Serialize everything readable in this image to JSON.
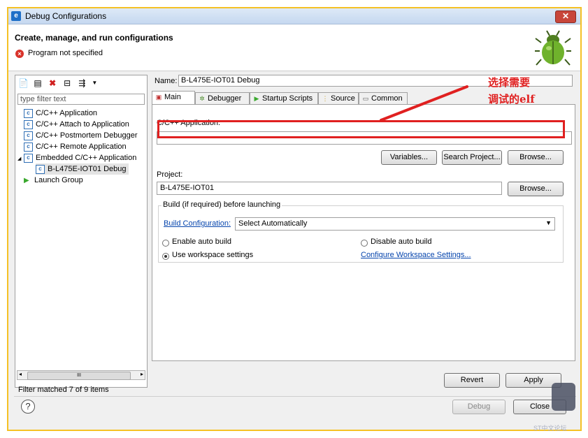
{
  "window": {
    "title": "Debug Configurations",
    "close_glyph": "✕"
  },
  "header": {
    "title": "Create, manage, and run configurations",
    "message": "Program not specified"
  },
  "left": {
    "filter_placeholder": "type filter text",
    "tree": [
      {
        "label": "C/C++ Application",
        "icon": "c-config-icon"
      },
      {
        "label": "C/C++ Attach to Application",
        "icon": "c-config-icon"
      },
      {
        "label": "C/C++ Postmortem Debugger",
        "icon": "c-config-icon"
      },
      {
        "label": "C/C++ Remote Application",
        "icon": "c-config-icon"
      },
      {
        "label": "Embedded C/C++ Application",
        "icon": "c-config-icon",
        "expanded": true
      },
      {
        "label": "B-L475E-IOT01 Debug",
        "icon": "c-config-icon",
        "selected": true
      },
      {
        "label": "Launch Group",
        "icon": "launch-group-icon"
      }
    ],
    "filter_status": "Filter matched 7 of 9 items",
    "scroll_glyph": "III"
  },
  "main": {
    "name_label": "Name:",
    "name_value": "B-L475E-IOT01 Debug",
    "tabs": [
      {
        "label": "Main",
        "icon": "main-tab-icon",
        "active": true
      },
      {
        "label": "Debugger",
        "icon": "debugger-tab-icon"
      },
      {
        "label": "Startup Scripts",
        "icon": "startup-tab-icon"
      },
      {
        "label": "Source",
        "icon": "source-tab-icon"
      },
      {
        "label": "Common",
        "icon": "common-tab-icon"
      }
    ],
    "app_label": "C/C++ Application:",
    "app_value": "",
    "variables_button": "Variables...",
    "search_project_button": "Search Project...",
    "browse_button": "Browse...",
    "project_label": "Project:",
    "project_value": "B-L475E-IOT01",
    "project_browse_button": "Browse...",
    "build_group_title": "Build (if required) before launching",
    "build_config_link": "Build Configuration:",
    "build_config_value": "Select Automatically",
    "enable_auto_build": "Enable auto build",
    "disable_auto_build": "Disable auto build",
    "use_workspace_settings": "Use workspace settings",
    "configure_workspace_link": "Configure Workspace Settings...",
    "revert_button": "Revert",
    "apply_button": "Apply"
  },
  "footer": {
    "debug_button": "Debug",
    "close_button": "Close",
    "help_glyph": "?"
  },
  "annotation": {
    "line1": "选择需要",
    "line2": "调试的elf",
    "color": "#e02020"
  },
  "watermark": "ST中文论坛"
}
